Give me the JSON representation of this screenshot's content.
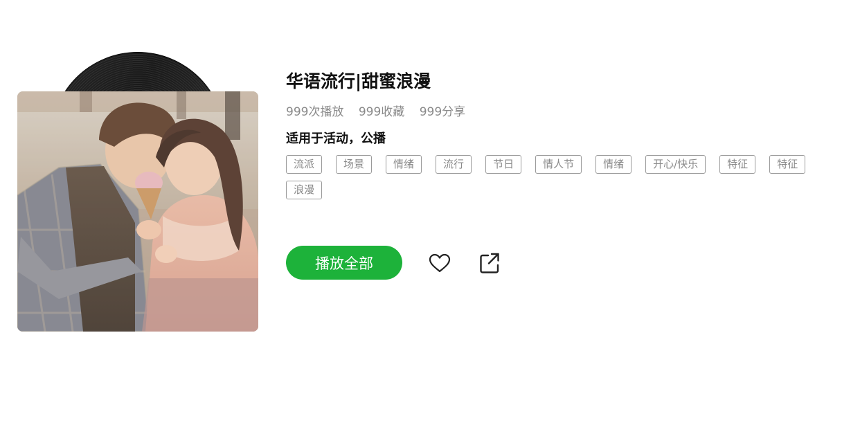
{
  "playlist": {
    "title": "华语流行|甜蜜浪漫",
    "stats": {
      "plays": "999次播放",
      "favorites": "999收藏",
      "shares": "999分享"
    },
    "usage": "适用于活动，公播",
    "tags": [
      "流派",
      "场景",
      "情绪",
      "流行",
      "节日",
      "情人节",
      "情绪",
      "开心/快乐",
      "特征",
      "特征",
      "浪漫"
    ],
    "play_all_label": "播放全部",
    "favorite_icon": "heart-icon",
    "share_icon": "share-icon"
  },
  "colors": {
    "accent": "#1db23a",
    "muted_text": "#8a8a8a",
    "tag_border": "#9a9a9a"
  }
}
